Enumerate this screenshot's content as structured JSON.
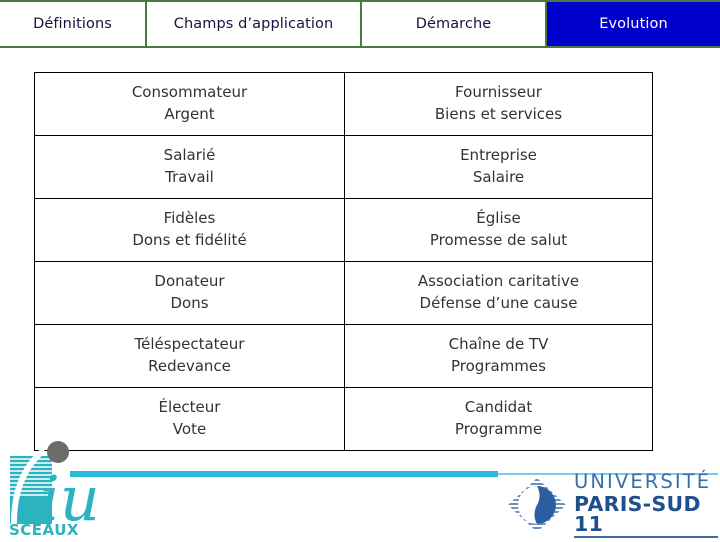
{
  "tabs": [
    {
      "label": "Définitions",
      "active": false
    },
    {
      "label": "Champs d’application",
      "active": false
    },
    {
      "label": "Démarche",
      "active": false
    },
    {
      "label": "Evolution",
      "active": true
    }
  ],
  "colors": {
    "tab_border": "#4a7a3f",
    "active_tab_bg": "#0000cc",
    "active_tab_text": "#ffffff",
    "tab_text": "#14143c",
    "table_border": "#000000",
    "table_text": "#333333",
    "rule_thick": "#29bcd9",
    "rule_thin": "#7ec9e8",
    "iut_teal": "#2bb3c0",
    "iut_dot": "#6b6b6b",
    "paris_blue": "#3a6ea8",
    "paris_dark_blue": "#1f4f8c"
  },
  "matrix": {
    "rows": [
      {
        "left": {
          "line1": "Consommateur",
          "line2": "Argent"
        },
        "right": {
          "line1": "Fournisseur",
          "line2": "Biens et services"
        }
      },
      {
        "left": {
          "line1": "Salarié",
          "line2": "Travail"
        },
        "right": {
          "line1": "Entreprise",
          "line2": "Salaire"
        }
      },
      {
        "left": {
          "line1": "Fidèles",
          "line2": "Dons et fidélité"
        },
        "right": {
          "line1": "Église",
          "line2": "Promesse de salut"
        }
      },
      {
        "left": {
          "line1": "Donateur",
          "line2": "Dons"
        },
        "right": {
          "line1": "Association caritative",
          "line2": "Défense d’une cause"
        }
      },
      {
        "left": {
          "line1": "Téléspectateur",
          "line2": "Redevance"
        },
        "right": {
          "line1": "Chaîne de TV",
          "line2": "Programmes"
        }
      },
      {
        "left": {
          "line1": "Électeur",
          "line2": "Vote"
        },
        "right": {
          "line1": "Candidat",
          "line2": "Programme"
        }
      }
    ]
  },
  "footer": {
    "iut_logo": {
      "mark": "iut",
      "city": "SCEAUX"
    },
    "paris_logo": {
      "line1": "UNIVERSITÉ",
      "line2": "PARIS-SUD 11"
    }
  }
}
